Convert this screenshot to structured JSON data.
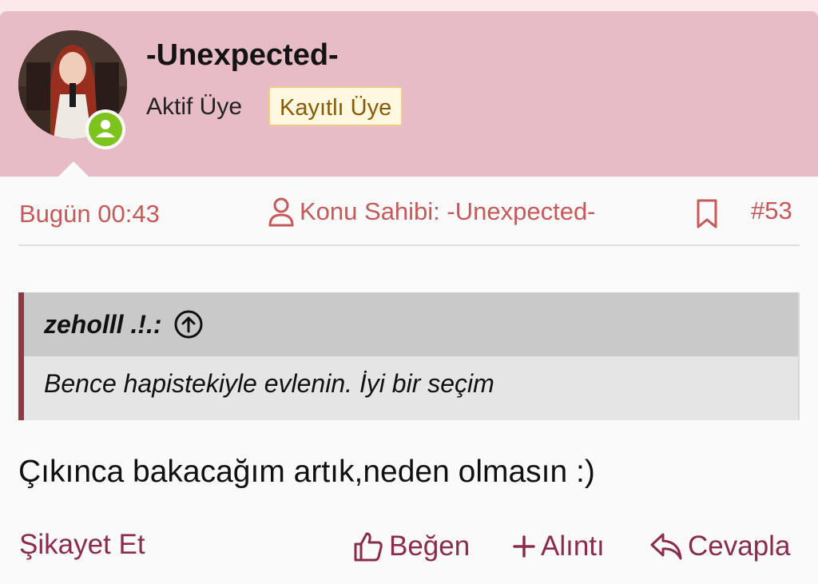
{
  "post": {
    "username": "-Unexpected-",
    "user_title": "Aktif Üye",
    "role_badge": "Kayıtlı Üye",
    "date": "Bugün 00:43",
    "owner_label": "Konu Sahibi: -Unexpected-",
    "post_number": "#53",
    "quote": {
      "author": "zeholll .!.:",
      "text": "Bence hapistekiyle evlenin. İyi bir seçim"
    },
    "body": "Çıkınca bakacağım artık,neden olmasın :)"
  },
  "actions": {
    "report": "Şikayet Et",
    "like": "Beğen",
    "quote": "Alıntı",
    "reply": "Cevapla"
  },
  "colors": {
    "header_bg": "#e7bcc6",
    "meta_text": "#c65a5a",
    "action_text": "#8b2c4a",
    "online_green": "#7cc31d",
    "quote_border": "#8b3a48"
  },
  "icons": [
    "user-icon",
    "bookmark-icon",
    "arrow-up-circle-icon",
    "thumbs-up-icon",
    "plus-icon",
    "reply-icon",
    "online-status-icon"
  ]
}
